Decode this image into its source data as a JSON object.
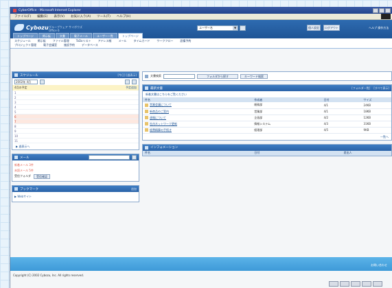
{
  "window": {
    "title": "CyberOffice - Microsoft Internet Explorer",
    "menu": [
      "ファイル(F)",
      "編集(E)",
      "表示(V)",
      "お気に入り(A)",
      "ツール(T)",
      "ヘルプ(H)"
    ]
  },
  "header": {
    "logo": "Cybozu",
    "tagline_1": "グループウェア サイボウズ",
    "tagline_2": "Office 6",
    "select_value": "ユーザー名",
    "btn_1": "個人設定",
    "btn_2": "ログアウト",
    "link": "ヘルプ 操作方法"
  },
  "tabs": [
    "トップページ",
    "掲示板",
    "文書",
    "電子メール",
    "ユーザー一覧",
    "トップページ"
  ],
  "subnav": {
    "row1": [
      "スケジュール",
      "掲示板",
      "ファイル管理",
      "ToDoリスト",
      "アドレス帳",
      "メール",
      "タイムカード",
      "ワークフロー",
      "設備予約"
    ],
    "row2": [
      "プロジェクト管理",
      "電子会議室",
      "施設予約",
      "データベース"
    ]
  },
  "calendar": {
    "title": "スケジュール",
    "header_extra": "[今日] [週表示]",
    "select": "2002年 4月",
    "band_label": "4月の予定",
    "add_link": "予定追加",
    "days": [
      {
        "n": "1",
        "weekend": false,
        "text": ""
      },
      {
        "n": "2",
        "weekend": false,
        "text": ""
      },
      {
        "n": "3",
        "weekend": false,
        "text": ""
      },
      {
        "n": "4",
        "weekend": false,
        "text": ""
      },
      {
        "n": "5",
        "weekend": false,
        "text": ""
      },
      {
        "n": "6",
        "weekend": true,
        "text": ""
      },
      {
        "n": "7",
        "weekend": true,
        "text": ""
      },
      {
        "n": "8",
        "weekend": false,
        "text": ""
      },
      {
        "n": "9",
        "weekend": false,
        "text": ""
      },
      {
        "n": "10",
        "weekend": false,
        "text": ""
      },
      {
        "n": "11",
        "weekend": false,
        "text": ""
      }
    ],
    "more_link": "▶ 週表示へ"
  },
  "mail": {
    "title": "メール",
    "line_1": "新着メール 3件",
    "line_2": "未読メール 5件",
    "line_3": "受信フォルダ",
    "check_btn": "受信確認"
  },
  "bookmark": {
    "title": "ブックマーク",
    "extra": "追加",
    "item": "▶ Webサイト"
  },
  "docsearch": {
    "label": "文書検索",
    "btn_1": "フォルダから探す",
    "btn_2": "キーワード検索"
  },
  "documents": {
    "title": "最新文書",
    "header_extra_1": "[フォルダ一覧]",
    "header_extra_2": "[すべて表示]",
    "info": "新着文書はこちらをご覧ください",
    "columns": [
      "件名",
      "作成者",
      "日付",
      "サイズ"
    ],
    "rows": [
      {
        "title": "営業会議について",
        "author": "総務部",
        "date": "4/1",
        "size": "24KB"
      },
      {
        "title": "新商品のご案内",
        "author": "営業部",
        "date": "4/1",
        "size": "18KB"
      },
      {
        "title": "週報について",
        "author": "企画部",
        "date": "4/2",
        "size": "12KB"
      },
      {
        "title": "社内ネットワーク更新",
        "author": "情報システム",
        "date": "4/3",
        "size": "31KB"
      },
      {
        "title": "経費精算の手続き",
        "author": "経理部",
        "date": "4/5",
        "size": "9KB"
      }
    ],
    "more_link": "一覧へ"
  },
  "announce": {
    "title": "インフォメーション",
    "columns": [
      "件名",
      "日付",
      "差出人"
    ]
  },
  "footer": {
    "link": "お問い合わせ",
    "copyright": "Copyright (C) 2002 Cybozu, Inc. All rights reserved."
  }
}
